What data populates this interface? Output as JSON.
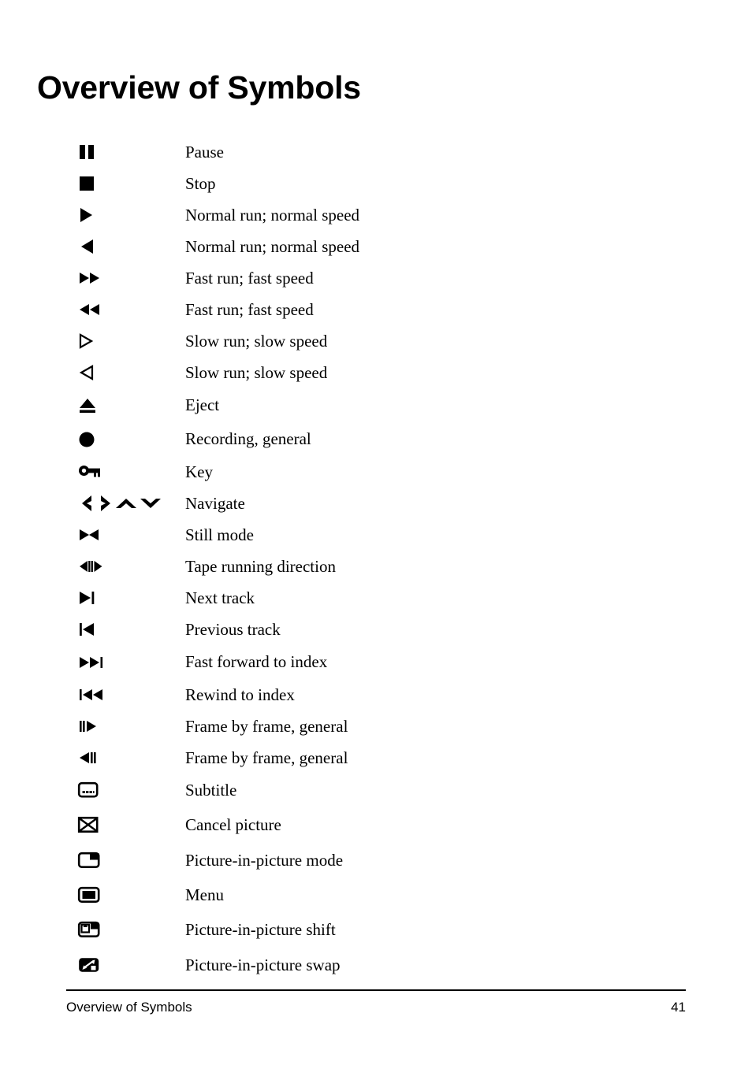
{
  "document": {
    "title": "Overview of Symbols"
  },
  "symbols": [
    {
      "icon": "pause-icon",
      "label": "Pause"
    },
    {
      "icon": "stop-icon",
      "label": "Stop"
    },
    {
      "icon": "play-forward-icon",
      "label": "Normal run; normal speed"
    },
    {
      "icon": "play-reverse-icon",
      "label": "Normal run; normal speed"
    },
    {
      "icon": "fast-forward-icon",
      "label": "Fast run; fast speed"
    },
    {
      "icon": "fast-rewind-icon",
      "label": "Fast run; fast speed"
    },
    {
      "icon": "slow-forward-icon",
      "label": "Slow run; slow speed"
    },
    {
      "icon": "slow-reverse-icon",
      "label": "Slow run; slow speed"
    },
    {
      "icon": "eject-icon",
      "label": "Eject"
    },
    {
      "icon": "record-icon",
      "label": "Recording, general"
    },
    {
      "icon": "key-icon",
      "label": "Key"
    },
    {
      "icon": "navigate-icon",
      "label": "Navigate"
    },
    {
      "icon": "still-mode-icon",
      "label": "Still mode"
    },
    {
      "icon": "tape-running-direction-icon",
      "label": "Tape running direction"
    },
    {
      "icon": "next-track-icon",
      "label": "Next track"
    },
    {
      "icon": "previous-track-icon",
      "label": "Previous track"
    },
    {
      "icon": "fast-forward-to-index-icon",
      "label": "Fast forward to index"
    },
    {
      "icon": "rewind-to-index-icon",
      "label": "Rewind to index"
    },
    {
      "icon": "frame-by-frame-forward-icon",
      "label": "Frame by frame, general"
    },
    {
      "icon": "frame-by-frame-reverse-icon",
      "label": "Frame by frame, general"
    },
    {
      "icon": "subtitle-icon",
      "label": "Subtitle"
    },
    {
      "icon": "cancel-picture-icon",
      "label": "Cancel picture"
    },
    {
      "icon": "picture-in-picture-mode-icon",
      "label": "Picture-in-picture mode"
    },
    {
      "icon": "menu-icon",
      "label": "Menu"
    },
    {
      "icon": "picture-in-picture-shift-icon",
      "label": "Picture-in-picture shift"
    },
    {
      "icon": "picture-in-picture-swap-icon",
      "label": "Picture-in-picture swap"
    }
  ],
  "footer": {
    "left": "Overview of Symbols",
    "page_number": "41"
  },
  "colors": {
    "ink": "#000000",
    "paper": "#ffffff"
  }
}
